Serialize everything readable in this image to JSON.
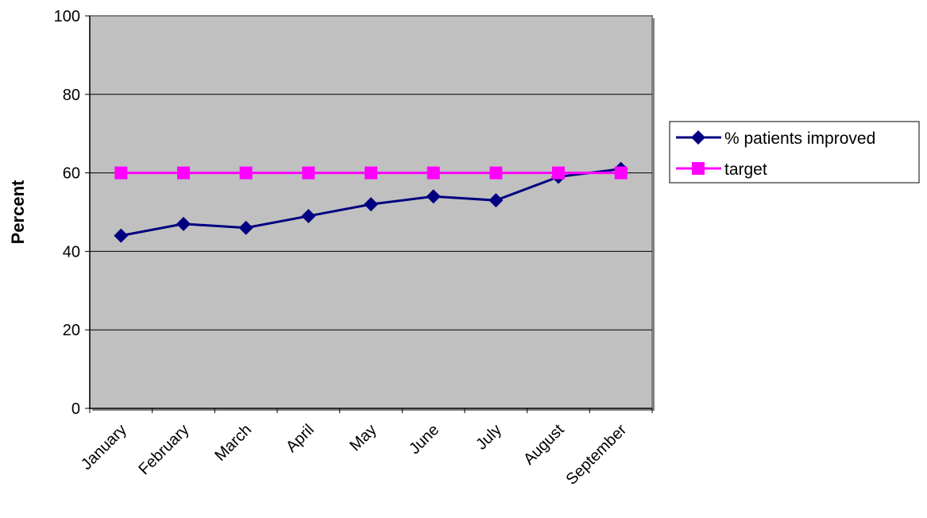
{
  "chart_data": {
    "type": "line",
    "title": "",
    "xlabel": "",
    "ylabel": "Percent",
    "ylim": [
      0,
      100
    ],
    "yticks": [
      0,
      20,
      40,
      60,
      80,
      100
    ],
    "grid": true,
    "plot_background": "#c0c0c0",
    "legend_position": "right",
    "categories": [
      "January",
      "February",
      "March",
      "April",
      "May",
      "June",
      "July",
      "August",
      "September"
    ],
    "series": [
      {
        "name": "% patients improved",
        "color": "#000080",
        "marker": "diamond",
        "values": [
          44,
          47,
          46,
          49,
          52,
          54,
          53,
          59,
          61
        ]
      },
      {
        "name": "target",
        "color": "#ff00ff",
        "marker": "square",
        "values": [
          60,
          60,
          60,
          60,
          60,
          60,
          60,
          60,
          60
        ]
      }
    ]
  }
}
